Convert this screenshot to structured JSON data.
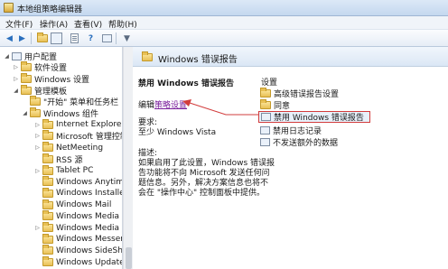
{
  "window": {
    "title": "本地组策略编辑器"
  },
  "menu": [
    "文件(F)",
    "操作(A)",
    "查看(V)",
    "帮助(H)"
  ],
  "toolbar": [
    "back-icon",
    "forward-icon",
    "up-folder-icon",
    "show-hide-tree-icon",
    "export-list-icon",
    "help-icon",
    "properties-icon",
    "filter-icon"
  ],
  "tree": [
    {
      "label": "用户配置",
      "level": 0,
      "expander": "expanded",
      "icon": "user-config-icon"
    },
    {
      "label": "软件设置",
      "level": 1,
      "expander": "collapsed",
      "icon": "folder-icon"
    },
    {
      "label": "Windows 设置",
      "level": 1,
      "expander": "collapsed",
      "icon": "folder-icon"
    },
    {
      "label": "管理模板",
      "level": 1,
      "expander": "expanded",
      "icon": "folder-icon"
    },
    {
      "label": "\"开始\" 菜单和任务栏",
      "level": 2,
      "expander": "",
      "icon": "folder-icon"
    },
    {
      "label": "Windows 组件",
      "level": 2,
      "expander": "expanded",
      "icon": "folder-icon"
    },
    {
      "label": "Internet Explorer",
      "level": 3,
      "expander": "collapsed",
      "icon": "folder-icon"
    },
    {
      "label": "Microsoft 管理控制台",
      "level": 3,
      "expander": "collapsed",
      "icon": "folder-icon"
    },
    {
      "label": "NetMeeting",
      "level": 3,
      "expander": "collapsed",
      "icon": "folder-icon"
    },
    {
      "label": "RSS 源",
      "level": 3,
      "expander": "",
      "icon": "folder-icon"
    },
    {
      "label": "Tablet PC",
      "level": 3,
      "expander": "collapsed",
      "icon": "folder-icon"
    },
    {
      "label": "Windows Anytime Upgrade",
      "level": 3,
      "expander": "",
      "icon": "folder-icon"
    },
    {
      "label": "Windows Installer",
      "level": 3,
      "expander": "",
      "icon": "folder-icon"
    },
    {
      "label": "Windows Mail",
      "level": 3,
      "expander": "",
      "icon": "folder-icon"
    },
    {
      "label": "Windows Media Center",
      "level": 3,
      "expander": "",
      "icon": "folder-icon"
    },
    {
      "label": "Windows Media Player",
      "level": 3,
      "expander": "collapsed",
      "icon": "folder-icon"
    },
    {
      "label": "Windows Messenger",
      "level": 3,
      "expander": "",
      "icon": "folder-icon"
    },
    {
      "label": "Windows SideShow",
      "level": 3,
      "expander": "",
      "icon": "folder-icon"
    },
    {
      "label": "Windows Update",
      "level": 3,
      "expander": "",
      "icon": "folder-icon"
    }
  ],
  "details": {
    "header": "Windows 错误报告",
    "title": "禁用 Windows 错误报告",
    "edit_prefix": "编辑",
    "edit_link": "策略设置",
    "requirements_label": "要求:",
    "requirements_value": "至少 Windows Vista",
    "description_label": "描述:",
    "description_lines": [
      "如果启用了此设置，Windows 错误报",
      "告功能将不向 Microsoft 发送任何问",
      "题信息。另外，解决方案信息也将不",
      "会在 \"操作中心\" 控制面板中提供。"
    ]
  },
  "settings": {
    "header": "设置",
    "items": [
      {
        "label": "高级错误报告设置",
        "icon": "folder-icon",
        "selected": false
      },
      {
        "label": "同意",
        "icon": "folder-icon",
        "selected": false
      },
      {
        "label": "禁用 Windows 错误报告",
        "icon": "policy-setting-icon",
        "selected": true
      },
      {
        "label": "禁用日志记录",
        "icon": "policy-setting-icon",
        "selected": false
      },
      {
        "label": "不发送额外的数据",
        "icon": "policy-setting-icon",
        "selected": false
      }
    ]
  },
  "colors": {
    "annotation": "#d23c3c",
    "link": "#7a1f9c"
  }
}
